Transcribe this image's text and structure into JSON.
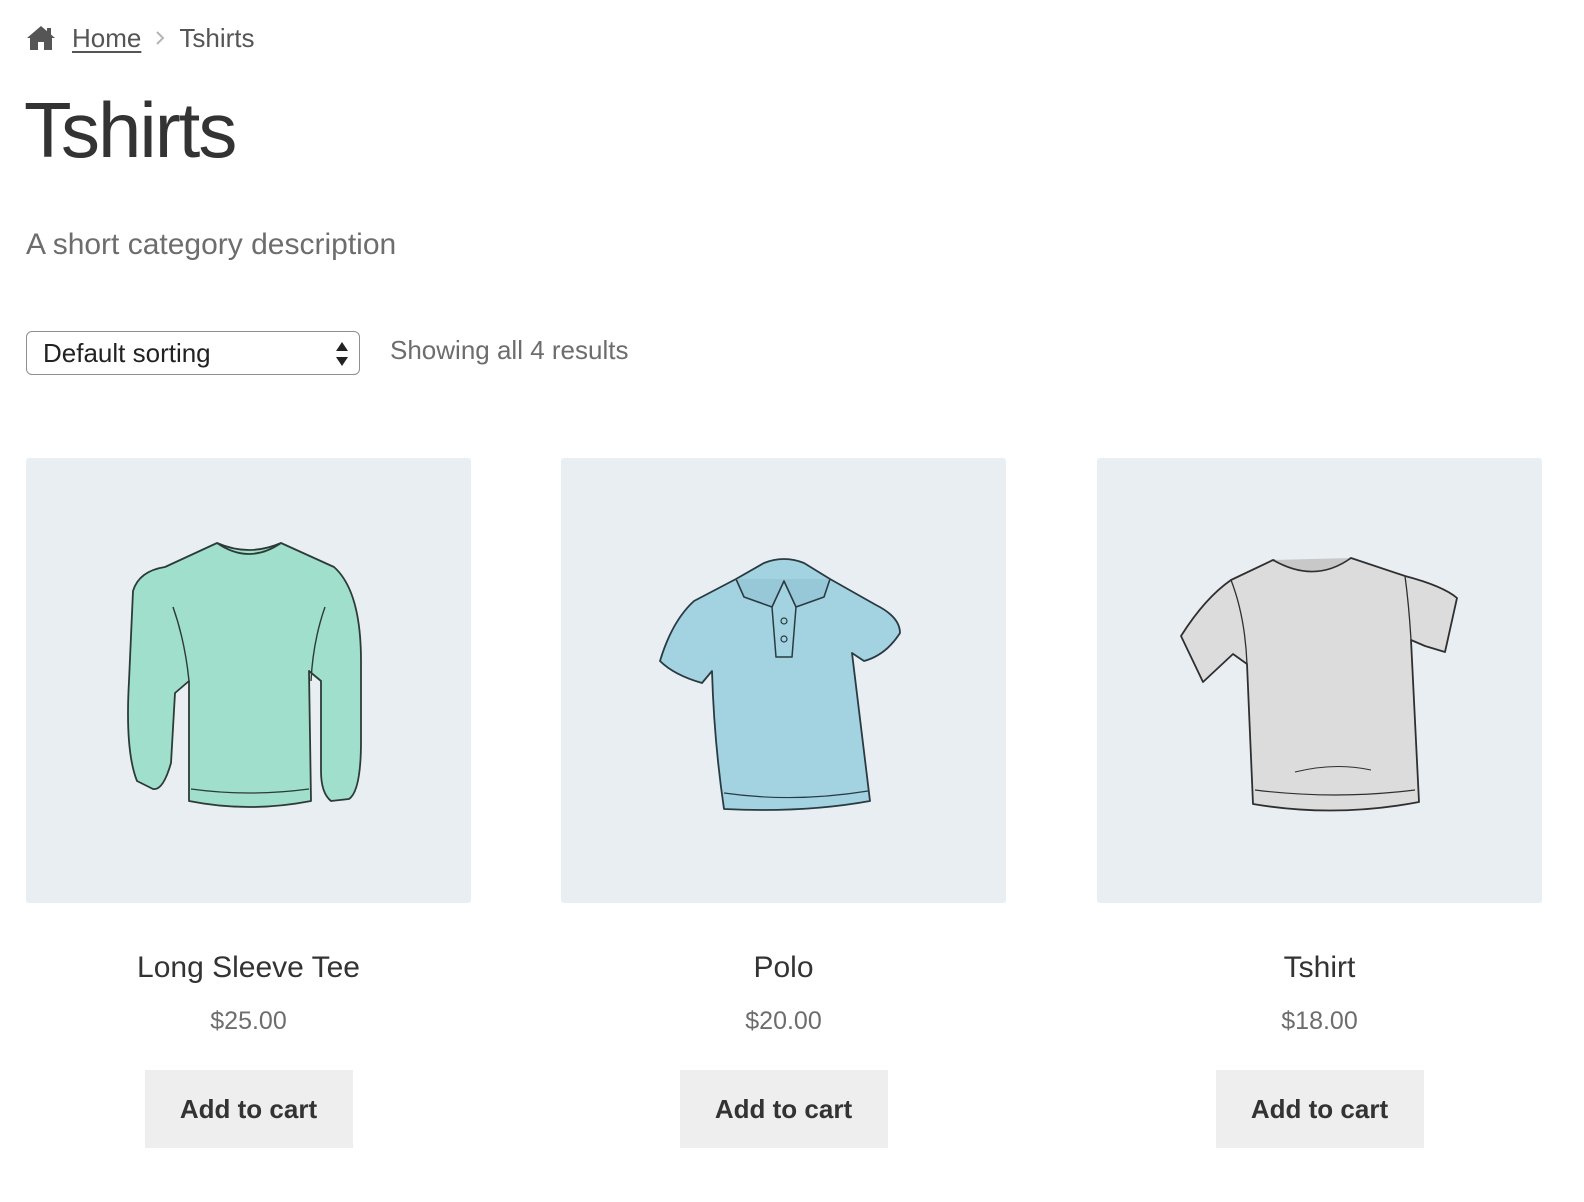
{
  "breadcrumb": {
    "icon": "home-icon",
    "home": "Home",
    "separator_icon": "chevron-right-icon",
    "current": "Tshirts"
  },
  "page_title": "Tshirts",
  "category_description": "A short category description",
  "toolbar": {
    "sort_selected": "Default sorting",
    "result_count": "Showing all 4 results"
  },
  "products": [
    {
      "name": "Long Sleeve Tee",
      "price": "$25.00",
      "button": "Add to cart",
      "image": "long-sleeve-tee-image",
      "color": "#9fdfcc"
    },
    {
      "name": "Polo",
      "price": "$20.00",
      "button": "Add to cart",
      "image": "polo-shirt-image",
      "color": "#a3d2e0"
    },
    {
      "name": "Tshirt",
      "price": "$18.00",
      "button": "Add to cart",
      "image": "tshirt-image",
      "color": "#dcdcdc"
    }
  ],
  "colors": {
    "thumb_bg": "#e9eef2",
    "button_bg": "#eeeeee",
    "text_dark": "#333333",
    "text_muted": "#6d6d6d"
  }
}
